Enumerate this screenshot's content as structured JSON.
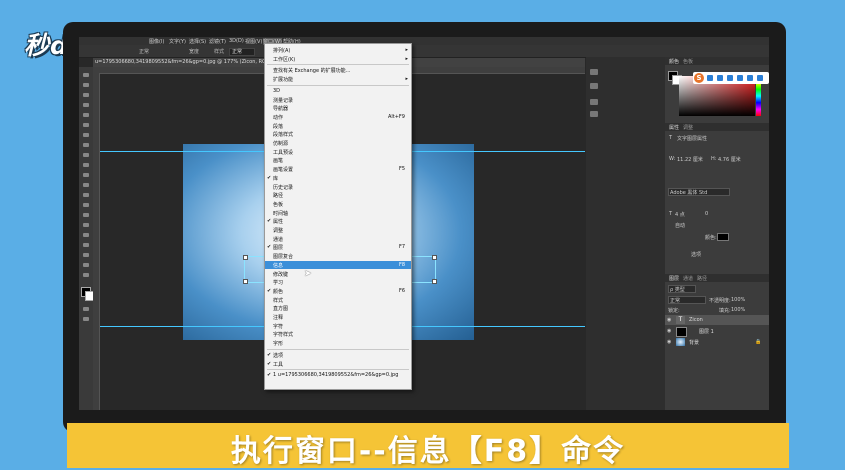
{
  "watermark": "秒dong视频",
  "caption": "执行窗口--信息【F8】命令",
  "menubar": {
    "items": [
      "图像(I)",
      "文字(Y)",
      "选择(S)",
      "滤镜(T)",
      "3D(D)",
      "视图(V)",
      "窗口(W)",
      "帮助(H)"
    ]
  },
  "options": {
    "mode_label": "正常",
    "width_label": "宽度",
    "height_label": "高度",
    "style_label": "样式",
    "style_value": "正常"
  },
  "document_tab": "u=1795306680,3419809552&fm=26&gp=0.jpg @ 177% (Zicon, RGB/8#) *",
  "window_menu": {
    "items": [
      {
        "label": "排列(A)",
        "arrow": "▸"
      },
      {
        "label": "工作区(K)",
        "arrow": "▸"
      },
      {
        "sep": true
      },
      {
        "label": "查找有关 Exchange 的扩展功能..."
      },
      {
        "label": "扩展功能",
        "arrow": "▸"
      },
      {
        "sep": true
      },
      {
        "label": "3D"
      },
      {
        "label": "测量记录"
      },
      {
        "label": "导航器"
      },
      {
        "label": "动作",
        "shortcut": "Alt+F9"
      },
      {
        "label": "段落"
      },
      {
        "label": "段落样式"
      },
      {
        "label": "仿制源"
      },
      {
        "label": "工具预设"
      },
      {
        "label": "画笔"
      },
      {
        "label": "画笔设置",
        "shortcut": "F5"
      },
      {
        "label": "库",
        "check": "✔"
      },
      {
        "label": "历史记录"
      },
      {
        "label": "路径"
      },
      {
        "label": "色板"
      },
      {
        "label": "时间轴"
      },
      {
        "label": "属性",
        "check": "✔"
      },
      {
        "label": "调整"
      },
      {
        "label": "通道"
      },
      {
        "label": "图层",
        "check": "✔",
        "shortcut": "F7"
      },
      {
        "label": "图层复合"
      },
      {
        "label": "信息",
        "shortcut": "F8",
        "highlight": true
      },
      {
        "label": "修改键"
      },
      {
        "label": "学习"
      },
      {
        "label": "颜色",
        "check": "✔",
        "shortcut": "F6"
      },
      {
        "label": "样式"
      },
      {
        "label": "直方图"
      },
      {
        "label": "注释"
      },
      {
        "label": "字符"
      },
      {
        "label": "字符样式"
      },
      {
        "label": "字形"
      },
      {
        "sep": true
      },
      {
        "label": "选项",
        "check": "✔"
      },
      {
        "label": "工具",
        "check": "✔"
      },
      {
        "sep": true
      },
      {
        "label": "1 u=1795306680,3419809552&fm=26&gp=0.jpg",
        "check": "✔"
      }
    ]
  },
  "color_panel": {
    "tab_color": "颜色",
    "tab_swatches": "色板",
    "fg": "#000000",
    "bg": "#ffffff"
  },
  "properties_panel": {
    "tab_props": "属性",
    "tab_adjust": "调整",
    "title": "文字图层属性",
    "w_label": "W:",
    "w_value": "11.22 厘米",
    "h_label": "H:",
    "h_value": "4.76 厘米",
    "font_family": "Adobe 黑体 Std",
    "size_value": "4 点",
    "leading_value": "0",
    "tracking_value": "自动",
    "color_label": "颜色:",
    "more": "选项"
  },
  "layers_panel": {
    "tab_layers": "图层",
    "tab_channels": "通道",
    "tab_paths": "路径",
    "kind_label": "ρ 类型",
    "blend_mode": "正常",
    "opacity_label": "不透明度:",
    "opacity_value": "100%",
    "lock_label": "锁定:",
    "fill_label": "填充:",
    "fill_value": "100%",
    "layers": [
      {
        "name": "Zicon",
        "type": "text"
      },
      {
        "name": "图层 1",
        "type": "black"
      },
      {
        "name": "背景",
        "type": "image"
      }
    ]
  }
}
